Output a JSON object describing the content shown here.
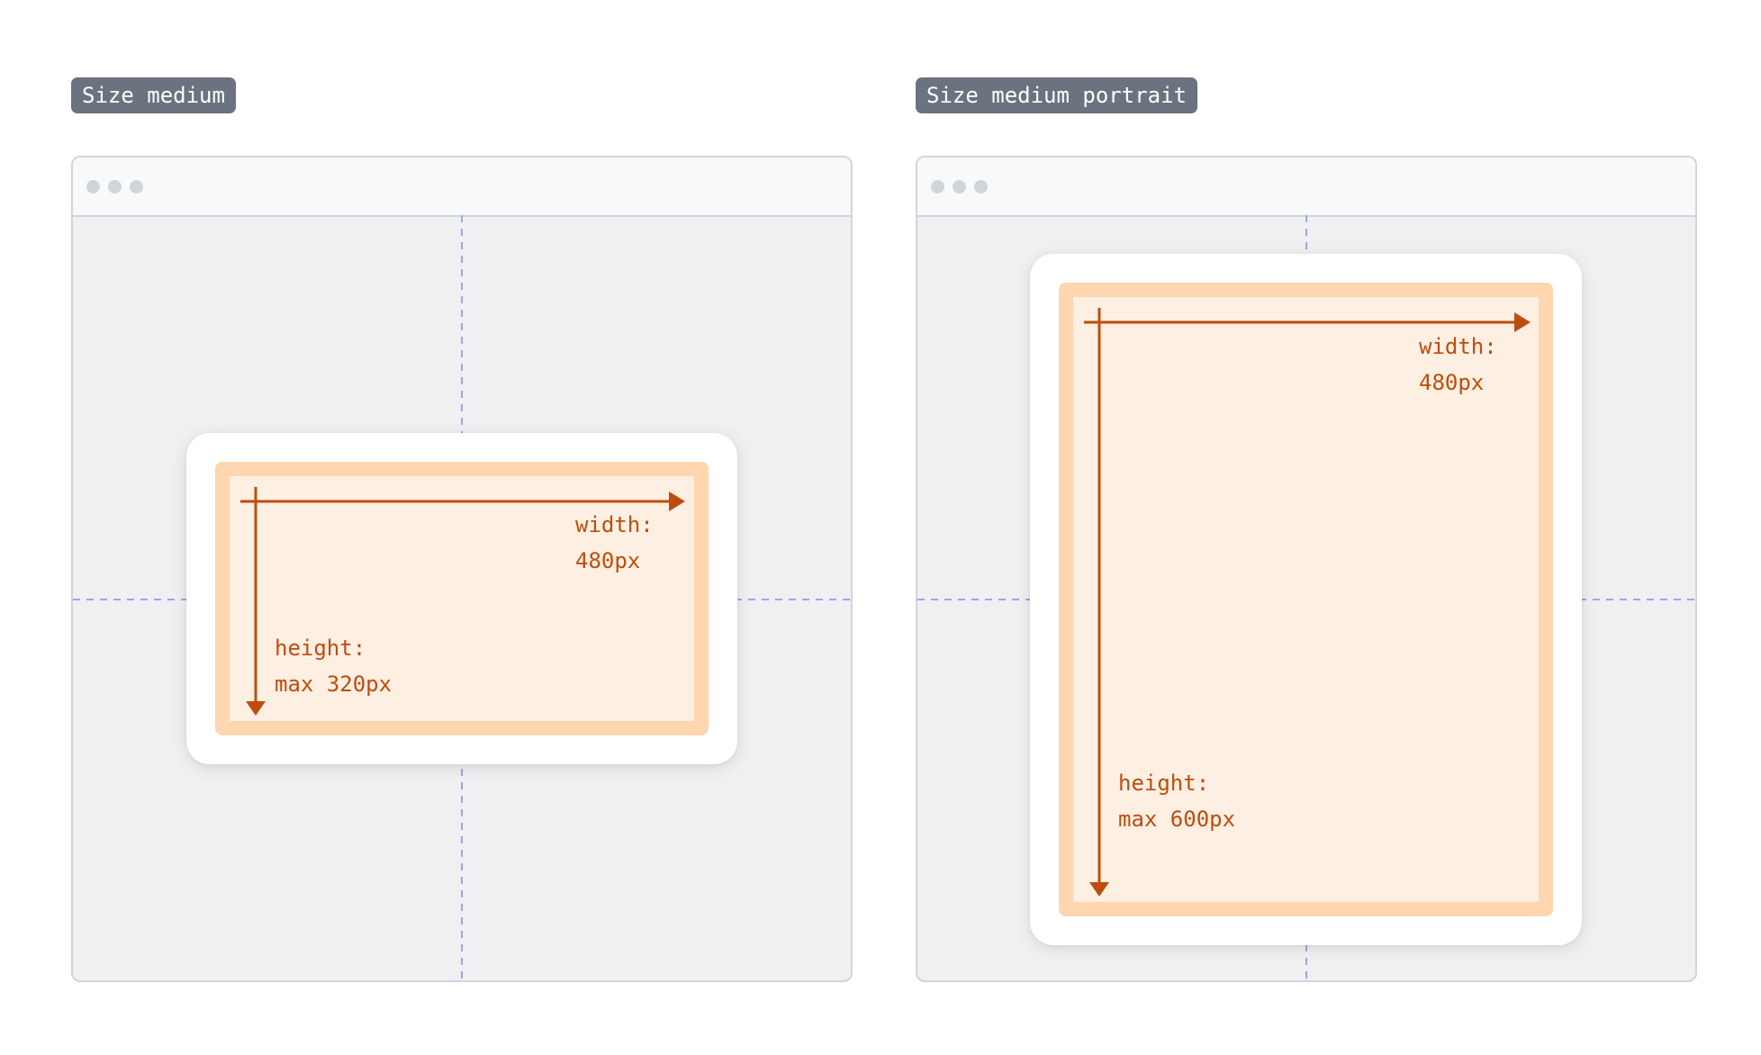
{
  "colors": {
    "pill_bg": "#6b7280",
    "window_bg": "#eff0f2",
    "titlebar_bg": "#f8f9fa",
    "border": "#d1d5db",
    "guide": "#a5a0ec",
    "dialog_bg": "#ffffff",
    "content_fill": "#fdefe2",
    "content_border": "#fed6b0",
    "arrow": "#bd4d0e"
  },
  "examples": [
    {
      "label": "Size medium",
      "width_label": "width:",
      "width_value": "480px",
      "height_label": "height:",
      "height_value": "max 320px"
    },
    {
      "label": "Size medium portrait",
      "width_label": "width:",
      "width_value": "480px",
      "height_label": "height:",
      "height_value": "max 600px"
    }
  ]
}
